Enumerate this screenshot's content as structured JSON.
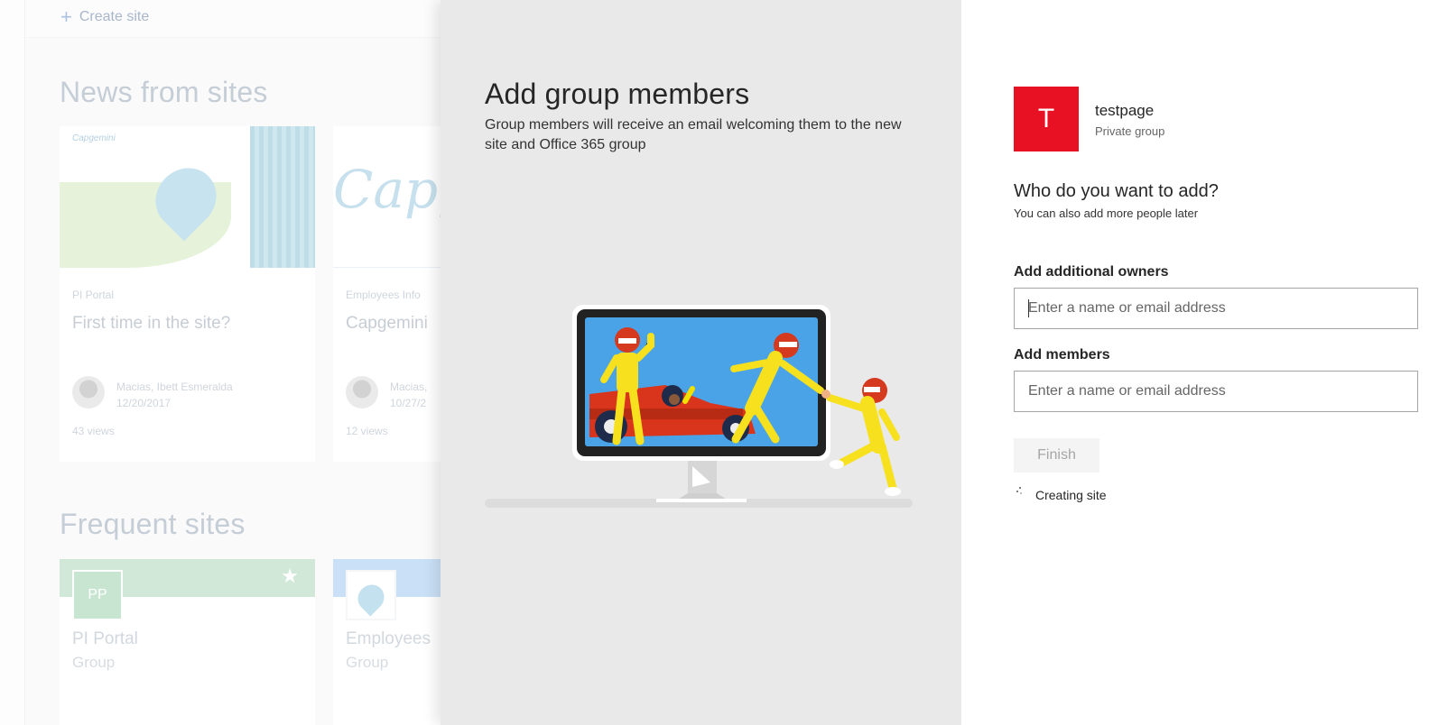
{
  "background": {
    "command_bar": {
      "create_site_label": "Create site"
    },
    "news": {
      "title": "News from sites",
      "cards": [
        {
          "image_logo": "Capgemini",
          "site": "PI Portal",
          "headline": "First time in the site?",
          "author": "Macias, Ibett Esmeralda",
          "date": "12/20/2017",
          "views": "43 views"
        },
        {
          "image_word": "Capge",
          "site": "Employees Info",
          "headline": "Capgemini",
          "author": "Macias,",
          "date": "10/27/2",
          "views": "12 views"
        }
      ]
    },
    "frequent": {
      "title": "Frequent sites",
      "sites": [
        {
          "initials": "PP",
          "name": "PI Portal",
          "type": "Group"
        },
        {
          "initials": "",
          "name": "Employees",
          "type": "Group"
        }
      ]
    }
  },
  "panel": {
    "title": "Add group members",
    "description": "Group members will receive an email welcoming them to the new site and Office 365 group",
    "group": {
      "initial": "T",
      "name": "testpage",
      "type": "Private group",
      "tile_color": "#e81123"
    },
    "who": {
      "title": "Who do you want to add?",
      "subtitle": "You can also add more people later"
    },
    "owners": {
      "label": "Add additional owners",
      "placeholder": "Enter a name or email address"
    },
    "members": {
      "label": "Add members",
      "placeholder": "Enter a name or email address"
    },
    "finish_label": "Finish",
    "status": "Creating site"
  }
}
